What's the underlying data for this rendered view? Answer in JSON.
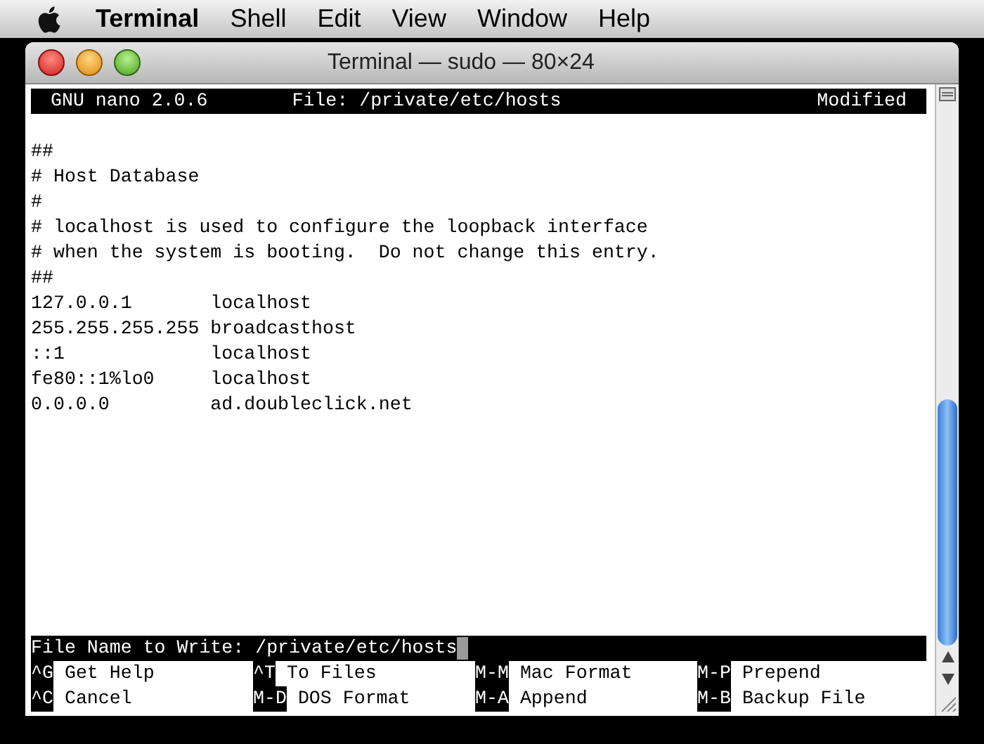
{
  "menu_bar": {
    "items": [
      {
        "label": "Terminal",
        "selected": true
      },
      {
        "label": "Shell",
        "selected": false
      },
      {
        "label": "Edit",
        "selected": false
      },
      {
        "label": "View",
        "selected": false
      },
      {
        "label": "Window",
        "selected": false
      },
      {
        "label": "Help",
        "selected": false
      }
    ]
  },
  "window": {
    "title": "Terminal — sudo — 80×24"
  },
  "nano_header": {
    "version": "GNU nano 2.0.6",
    "file": "File: /private/etc/hosts",
    "status": "Modified"
  },
  "lines": [
    "##",
    "# Host Database",
    "#",
    "# localhost is used to configure the loopback interface",
    "# when the system is booting.  Do not change this entry.",
    "##",
    "127.0.0.1       localhost",
    "255.255.255.255 broadcasthost",
    "::1             localhost",
    "fe80::1%lo0     localhost",
    "0.0.0.0         ad.doubleclick.net"
  ],
  "prompt": {
    "label": "File Name to Write: /private/etc/hosts"
  },
  "shortcuts": [
    [
      {
        "key": "^G",
        "label": "Get Help"
      },
      {
        "key": "^T",
        "label": "To Files"
      },
      {
        "key": "M-M",
        "label": "Mac Format"
      },
      {
        "key": "M-P",
        "label": "Prepend"
      }
    ],
    [
      {
        "key": "^C",
        "label": "Cancel"
      },
      {
        "key": "M-D",
        "label": "DOS Format"
      },
      {
        "key": "M-A",
        "label": "Append"
      },
      {
        "key": "M-B",
        "label": "Backup File"
      }
    ]
  ]
}
